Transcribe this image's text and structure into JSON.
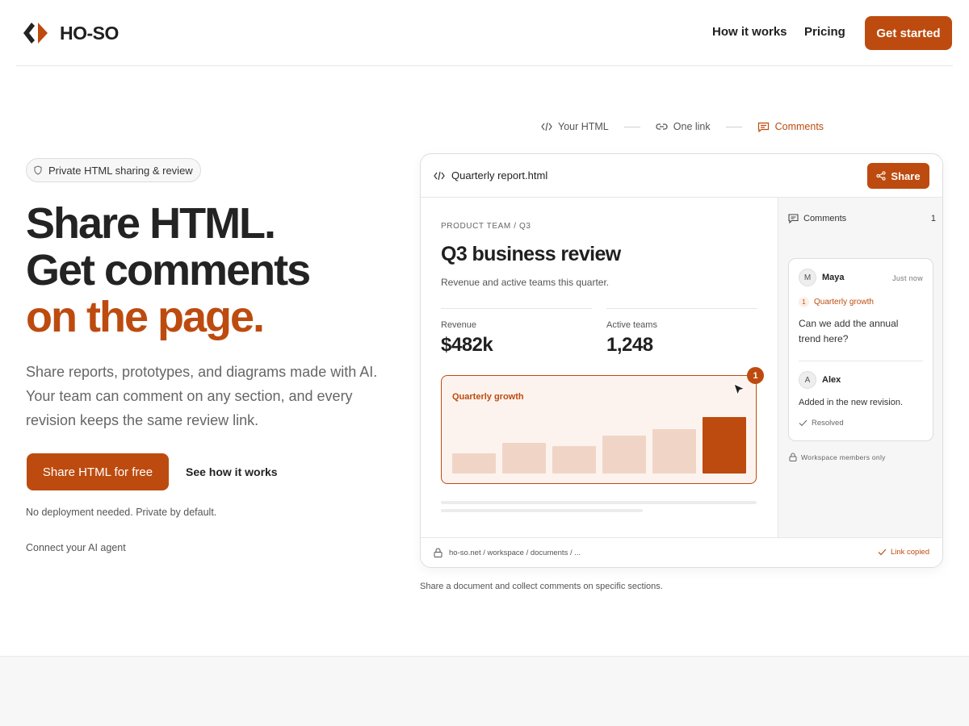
{
  "brand": {
    "name": "HO-SO",
    "accent": "#bd4b0f",
    "dark": "#232323"
  },
  "nav": {
    "links": [
      {
        "label": "How it works"
      },
      {
        "label": "Pricing"
      }
    ],
    "cta": "Get started"
  },
  "hero": {
    "badge": "Private HTML sharing & review",
    "headline": [
      "Share HTML.",
      "Get comments",
      "on the page."
    ],
    "lede": "Share reports, prototypes, and diagrams made with AI. Your team can comment on any section, and every revision keeps the same review link.",
    "primary_cta": "Share HTML for free",
    "secondary_cta": "See how it works",
    "note": "No deployment needed. Private by default.",
    "agent_link": "Connect your AI agent"
  },
  "steps": [
    {
      "label": "Your HTML",
      "icon": "code-icon"
    },
    {
      "label": "One link",
      "icon": "link-icon"
    },
    {
      "label": "Comments",
      "icon": "comment-icon",
      "active": true
    }
  ],
  "preview": {
    "file_name": "Quarterly report.html",
    "share_label": "Share",
    "doc": {
      "eyebrow": "PRODUCT TEAM / Q3",
      "title": "Q3 business review",
      "subtitle": "Revenue and active teams this quarter.",
      "metrics": [
        {
          "label": "Revenue",
          "value": "$482k"
        },
        {
          "label": "Active teams",
          "value": "1,248"
        }
      ],
      "growth_title": "Quarterly growth",
      "growth_bars": [
        0.36,
        0.54,
        0.48,
        0.67,
        0.79,
        1.0
      ],
      "highlight_index": 5,
      "comment_badge": "1"
    },
    "comments": {
      "header": "Comments",
      "count": "1",
      "thread": {
        "author": {
          "initial": "M",
          "name": "Maya"
        },
        "time": "Just now",
        "anchor_num": "1",
        "anchor_label": "Quarterly growth",
        "text": "Can we add the annual trend here?",
        "reply": {
          "initial": "A",
          "name": "Alex",
          "text": "Added in the new revision."
        },
        "status": "Resolved"
      },
      "members_note": "Workspace members only"
    },
    "url": "ho-so.net / workspace / documents / ...",
    "link_status": "Link copied"
  },
  "caption": "Share a document and collect comments on specific sections."
}
